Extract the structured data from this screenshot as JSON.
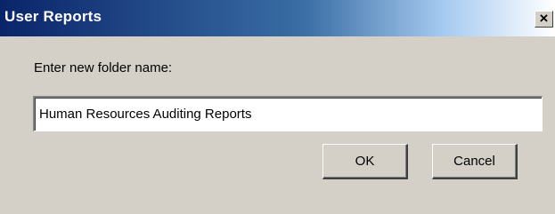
{
  "dialog": {
    "title": "User Reports",
    "close_glyph": "×",
    "prompt": "Enter new folder name:",
    "folder_name_value": "Human Resources Auditing Reports",
    "ok_label": "OK",
    "cancel_label": "Cancel"
  },
  "icons": {
    "close": "close-icon"
  },
  "colors": {
    "titlebar_start": "#0a246a",
    "titlebar_end": "#a6caf0",
    "dialog_background": "#d4d0c8"
  }
}
